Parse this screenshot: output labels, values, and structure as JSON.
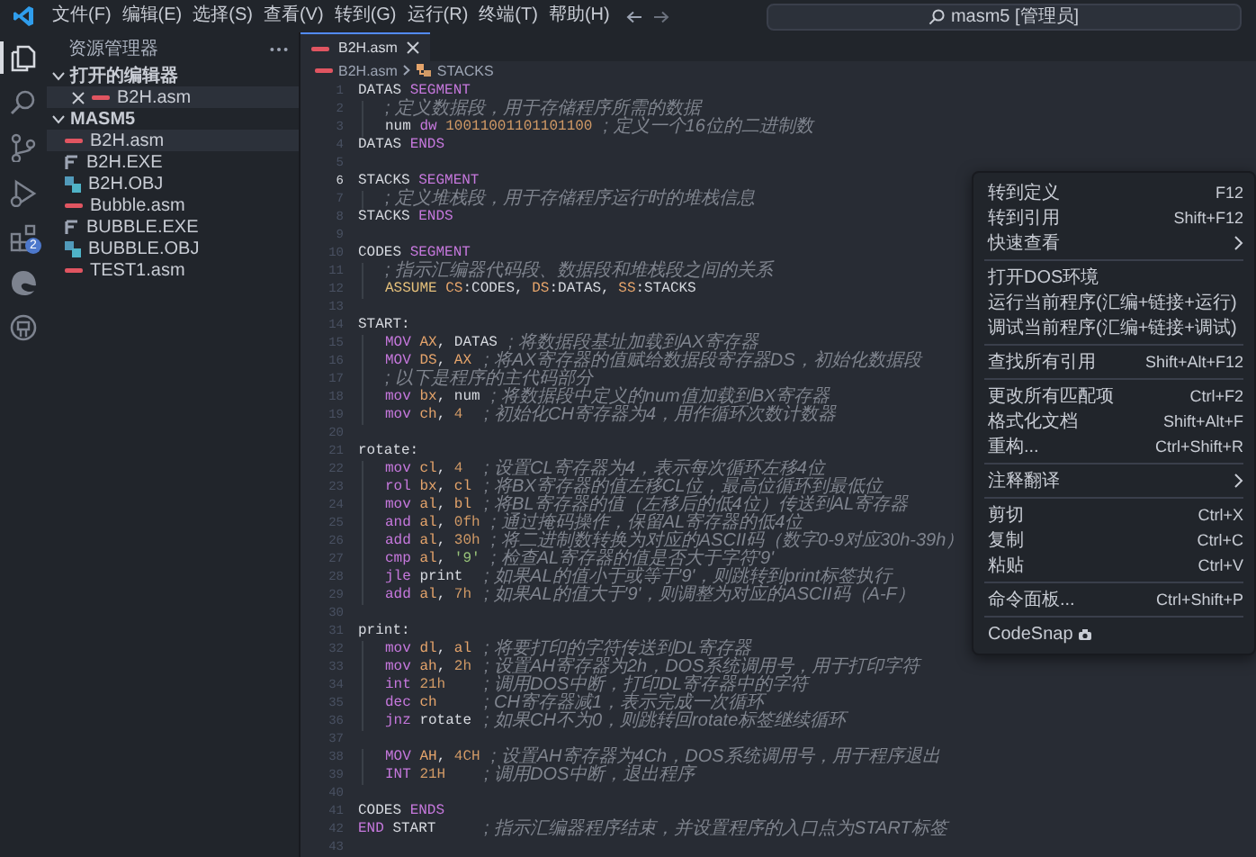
{
  "title_bar": {
    "menus": [
      "文件(F)",
      "编辑(E)",
      "选择(S)",
      "查看(V)",
      "转到(G)",
      "运行(R)",
      "终端(T)",
      "帮助(H)"
    ],
    "command_center": "masm5 [管理员]"
  },
  "activity_bar": {
    "items": [
      {
        "kind": "explorer",
        "selected": true
      },
      {
        "kind": "search",
        "selected": false
      },
      {
        "kind": "source-control",
        "selected": false
      },
      {
        "kind": "run",
        "selected": false
      },
      {
        "kind": "extensions",
        "selected": false,
        "badge": "2"
      },
      {
        "kind": "edge",
        "selected": false
      },
      {
        "kind": "github",
        "selected": false
      }
    ]
  },
  "sidebar": {
    "title": "资源管理器",
    "sections": [
      {
        "title": "打开的编辑器",
        "expanded": true,
        "items": [
          {
            "name": "B2H.asm",
            "kind": "asm",
            "selected": true,
            "closable": true
          }
        ]
      },
      {
        "title": "MASM5",
        "expanded": true,
        "items": [
          {
            "name": "B2H.asm",
            "kind": "asm",
            "selected": true,
            "closable": false
          },
          {
            "name": "B2H.EXE",
            "kind": "exe",
            "selected": false,
            "closable": false
          },
          {
            "name": "B2H.OBJ",
            "kind": "obj",
            "selected": false,
            "closable": false
          },
          {
            "name": "Bubble.asm",
            "kind": "asm",
            "selected": false,
            "closable": false
          },
          {
            "name": "BUBBLE.EXE",
            "kind": "exe",
            "selected": false,
            "closable": false
          },
          {
            "name": "BUBBLE.OBJ",
            "kind": "obj",
            "selected": false,
            "closable": false
          },
          {
            "name": "TEST1.asm",
            "kind": "asm",
            "selected": false,
            "closable": false
          }
        ]
      }
    ]
  },
  "editor": {
    "tabs": [
      {
        "label": "B2H.asm",
        "selected": true
      }
    ],
    "breadcrumb": [
      {
        "label": "B2H.asm",
        "kind": "file"
      },
      {
        "label": "STACKS",
        "kind": "symbol"
      }
    ],
    "lines": [
      {
        "number": "1",
        "current": false,
        "indented": false,
        "code": [
          {
            "text": "DATAS",
            "kind": "plain"
          },
          {
            "text": "SEGMENT",
            "kind": "keyword"
          }
        ]
      },
      {
        "number": "2",
        "current": false,
        "indented": true,
        "comment": "; 定义数据段，用于存储程序所需的数据"
      },
      {
        "number": "3",
        "current": false,
        "indented": true,
        "code": [
          {
            "text": "num",
            "kind": "plain"
          },
          {
            "text": "dw",
            "kind": "keyword"
          },
          {
            "text": "10011001101101100",
            "kind": "number"
          }
        ],
        "comment": "; 定义一个16位的二进制数"
      },
      {
        "number": "4",
        "current": false,
        "indented": false,
        "code": [
          {
            "text": "DATAS",
            "kind": "plain"
          },
          {
            "text": "ENDS",
            "kind": "keyword"
          }
        ]
      },
      {
        "number": "5",
        "current": false,
        "indented": false
      },
      {
        "number": "6",
        "current": true,
        "indented": false,
        "code": [
          {
            "text": "STACKS",
            "kind": "plain"
          },
          {
            "text": "SEGMENT",
            "kind": "keyword"
          }
        ]
      },
      {
        "number": "7",
        "current": false,
        "indented": true,
        "comment": "; 定义堆栈段，用于存储程序运行时的堆栈信息"
      },
      {
        "number": "8",
        "current": false,
        "indented": false,
        "code": [
          {
            "text": "STACKS",
            "kind": "plain"
          },
          {
            "text": "ENDS",
            "kind": "keyword"
          }
        ]
      },
      {
        "number": "9",
        "current": false,
        "indented": false
      },
      {
        "number": "10",
        "current": false,
        "indented": false,
        "code": [
          {
            "text": "CODES",
            "kind": "plain"
          },
          {
            "text": "SEGMENT",
            "kind": "keyword"
          }
        ]
      },
      {
        "number": "11",
        "current": false,
        "indented": true,
        "comment": "; 指示汇编器代码段、数据段和堆栈段之间的关系"
      },
      {
        "number": "12",
        "current": false,
        "indented": true,
        "code": [
          {
            "text": "ASSUME",
            "kind": "directive"
          },
          {
            "text": "CS",
            "kind": "register"
          },
          {
            "text": ":CODES,",
            "kind": "punct"
          },
          {
            "text": "DS",
            "kind": "register"
          },
          {
            "text": ":DATAS,",
            "kind": "punct"
          },
          {
            "text": "SS",
            "kind": "register"
          },
          {
            "text": ":STACKS",
            "kind": "punct"
          }
        ]
      },
      {
        "number": "13",
        "current": false,
        "indented": false
      },
      {
        "number": "14",
        "current": false,
        "indented": false,
        "code": [
          {
            "text": "START:",
            "kind": "plain"
          }
        ]
      },
      {
        "number": "15",
        "current": false,
        "indented": true,
        "code": [
          {
            "text": "MOV",
            "kind": "keyword"
          },
          {
            "text": "AX",
            "kind": "register"
          },
          {
            "text": ",",
            "kind": "punct"
          },
          {
            "text": "DATAS",
            "kind": "plain"
          }
        ],
        "comment": "; 将数据段基址加载到AX寄存器"
      },
      {
        "number": "16",
        "current": false,
        "indented": true,
        "code": [
          {
            "text": "MOV",
            "kind": "keyword"
          },
          {
            "text": "DS",
            "kind": "register"
          },
          {
            "text": ",",
            "kind": "punct"
          },
          {
            "text": "AX",
            "kind": "register"
          }
        ],
        "comment": "; 将AX寄存器的值赋给数据段寄存器DS，初始化数据段"
      },
      {
        "number": "17",
        "current": false,
        "indented": true,
        "comment": "; 以下是程序的主代码部分"
      },
      {
        "number": "18",
        "current": false,
        "indented": true,
        "code": [
          {
            "text": "mov",
            "kind": "keyword"
          },
          {
            "text": "bx",
            "kind": "register"
          },
          {
            "text": ",",
            "kind": "punct"
          },
          {
            "text": "num",
            "kind": "plain"
          }
        ],
        "comment": "; 将数据段中定义的num值加载到BX寄存器"
      },
      {
        "number": "19",
        "current": false,
        "indented": true,
        "code": [
          {
            "text": "mov",
            "kind": "keyword"
          },
          {
            "text": "ch",
            "kind": "register"
          },
          {
            "text": ",",
            "kind": "punct"
          },
          {
            "text": "4",
            "kind": "number"
          }
        ],
        "comment": "; 初始化CH寄存器为4，用作循环次数计数器"
      },
      {
        "number": "20",
        "current": false,
        "indented": false
      },
      {
        "number": "21",
        "current": false,
        "indented": false,
        "code": [
          {
            "text": "rotate:",
            "kind": "plain"
          }
        ]
      },
      {
        "number": "22",
        "current": false,
        "indented": true,
        "code": [
          {
            "text": "mov",
            "kind": "keyword"
          },
          {
            "text": "cl",
            "kind": "register"
          },
          {
            "text": ",",
            "kind": "punct"
          },
          {
            "text": "4",
            "kind": "number"
          }
        ],
        "comment": "; 设置CL寄存器为4，表示每次循环左移4位"
      },
      {
        "number": "23",
        "current": false,
        "indented": true,
        "code": [
          {
            "text": "rol",
            "kind": "keyword"
          },
          {
            "text": "bx",
            "kind": "register"
          },
          {
            "text": ",",
            "kind": "punct"
          },
          {
            "text": "cl",
            "kind": "register"
          }
        ],
        "comment": "; 将BX寄存器的值左移CL位，最高位循环到最低位"
      },
      {
        "number": "24",
        "current": false,
        "indented": true,
        "code": [
          {
            "text": "mov",
            "kind": "keyword"
          },
          {
            "text": "al",
            "kind": "register"
          },
          {
            "text": ",",
            "kind": "punct"
          },
          {
            "text": "bl",
            "kind": "register"
          }
        ],
        "comment": "; 将BL寄存器的值（左移后的低4位）传送到AL寄存器"
      },
      {
        "number": "25",
        "current": false,
        "indented": true,
        "code": [
          {
            "text": "and",
            "kind": "keyword"
          },
          {
            "text": "al",
            "kind": "register"
          },
          {
            "text": ",",
            "kind": "punct"
          },
          {
            "text": "0fh",
            "kind": "number"
          }
        ],
        "comment": "; 通过掩码操作，保留AL寄存器的低4位"
      },
      {
        "number": "26",
        "current": false,
        "indented": true,
        "code": [
          {
            "text": "add",
            "kind": "keyword"
          },
          {
            "text": "al",
            "kind": "register"
          },
          {
            "text": ",",
            "kind": "punct"
          },
          {
            "text": "30h",
            "kind": "number"
          }
        ],
        "comment": "; 将二进制数转换为对应的ASCII码（数字0-9对应30h-39h）"
      },
      {
        "number": "27",
        "current": false,
        "indented": true,
        "code": [
          {
            "text": "cmp",
            "kind": "keyword"
          },
          {
            "text": "al",
            "kind": "register"
          },
          {
            "text": ",",
            "kind": "punct"
          },
          {
            "text": "'9'",
            "kind": "string"
          }
        ],
        "comment": "; 检查AL寄存器的值是否大于字符'9'"
      },
      {
        "number": "28",
        "current": false,
        "indented": true,
        "code": [
          {
            "text": "jle",
            "kind": "keyword"
          },
          {
            "text": "print",
            "kind": "plain"
          }
        ],
        "comment": "; 如果AL的值小于或等于'9'，则跳转到print标签执行"
      },
      {
        "number": "29",
        "current": false,
        "indented": true,
        "code": [
          {
            "text": "add",
            "kind": "keyword"
          },
          {
            "text": "al",
            "kind": "register"
          },
          {
            "text": ",",
            "kind": "punct"
          },
          {
            "text": "7h",
            "kind": "number"
          }
        ],
        "comment": "; 如果AL的值大于'9'，则调整为对应的ASCII码（A-F）"
      },
      {
        "number": "30",
        "current": false,
        "indented": false
      },
      {
        "number": "31",
        "current": false,
        "indented": false,
        "code": [
          {
            "text": "print:",
            "kind": "plain"
          }
        ]
      },
      {
        "number": "32",
        "current": false,
        "indented": true,
        "code": [
          {
            "text": "mov",
            "kind": "keyword"
          },
          {
            "text": "dl",
            "kind": "register"
          },
          {
            "text": ",",
            "kind": "punct"
          },
          {
            "text": "al",
            "kind": "register"
          }
        ],
        "comment": "; 将要打印的字符传送到DL寄存器"
      },
      {
        "number": "33",
        "current": false,
        "indented": true,
        "code": [
          {
            "text": "mov",
            "kind": "keyword"
          },
          {
            "text": "ah",
            "kind": "register"
          },
          {
            "text": ",",
            "kind": "punct"
          },
          {
            "text": "2h",
            "kind": "number"
          }
        ],
        "comment": "; 设置AH寄存器为2h，DOS系统调用号，用于打印字符"
      },
      {
        "number": "34",
        "current": false,
        "indented": true,
        "code": [
          {
            "text": "int",
            "kind": "keyword"
          },
          {
            "text": "21h",
            "kind": "number"
          }
        ],
        "comment": "; 调用DOS中断，打印DL寄存器中的字符"
      },
      {
        "number": "35",
        "current": false,
        "indented": true,
        "code": [
          {
            "text": "dec",
            "kind": "keyword"
          },
          {
            "text": "ch",
            "kind": "register"
          }
        ],
        "comment": "; CH寄存器减1，表示完成一次循环"
      },
      {
        "number": "36",
        "current": false,
        "indented": true,
        "code": [
          {
            "text": "jnz",
            "kind": "keyword"
          },
          {
            "text": "rotate",
            "kind": "plain"
          }
        ],
        "comment": "; 如果CH不为0，则跳转回rotate标签继续循环"
      },
      {
        "number": "37",
        "current": false,
        "indented": false
      },
      {
        "number": "38",
        "current": false,
        "indented": true,
        "code": [
          {
            "text": "MOV",
            "kind": "keyword"
          },
          {
            "text": "AH",
            "kind": "register"
          },
          {
            "text": ",",
            "kind": "punct"
          },
          {
            "text": "4CH",
            "kind": "number"
          }
        ],
        "comment": "; 设置AH寄存器为4Ch，DOS系统调用号，用于程序退出"
      },
      {
        "number": "39",
        "current": false,
        "indented": true,
        "code": [
          {
            "text": "INT",
            "kind": "keyword"
          },
          {
            "text": "21H",
            "kind": "number"
          }
        ],
        "comment": "; 调用DOS中断，退出程序"
      },
      {
        "number": "40",
        "current": false,
        "indented": false
      },
      {
        "number": "41",
        "current": false,
        "indented": false,
        "code": [
          {
            "text": "CODES",
            "kind": "plain"
          },
          {
            "text": "ENDS",
            "kind": "keyword"
          }
        ]
      },
      {
        "number": "42",
        "current": false,
        "indented": false,
        "code": [
          {
            "text": "END",
            "kind": "keyword"
          },
          {
            "text": "START",
            "kind": "plain"
          }
        ],
        "comment": "; 指示汇编器程序结束，并设置程序的入口点为START标签"
      },
      {
        "number": "43",
        "current": false,
        "indented": false
      }
    ]
  },
  "context_menu": {
    "groups": [
      {
        "items": [
          {
            "label": "转到定义",
            "shortcut": "F12",
            "kind": "command"
          },
          {
            "label": "转到引用",
            "shortcut": "Shift+F12",
            "kind": "command"
          },
          {
            "label": "快速查看",
            "kind": "submenu"
          }
        ]
      },
      {
        "items": [
          {
            "label": "打开DOS环境",
            "kind": "command"
          },
          {
            "label": "运行当前程序(汇编+链接+运行)",
            "kind": "command"
          },
          {
            "label": "调试当前程序(汇编+链接+调试)",
            "kind": "command"
          }
        ]
      },
      {
        "items": [
          {
            "label": "查找所有引用",
            "shortcut": "Shift+Alt+F12",
            "kind": "command"
          }
        ]
      },
      {
        "items": [
          {
            "label": "更改所有匹配项",
            "shortcut": "Ctrl+F2",
            "kind": "command"
          },
          {
            "label": "格式化文档",
            "shortcut": "Shift+Alt+F",
            "kind": "command"
          },
          {
            "label": "重构...",
            "shortcut": "Ctrl+Shift+R",
            "kind": "command"
          }
        ]
      },
      {
        "items": [
          {
            "label": "注释翻译",
            "kind": "submenu"
          }
        ]
      },
      {
        "items": [
          {
            "label": "剪切",
            "shortcut": "Ctrl+X",
            "kind": "command"
          },
          {
            "label": "复制",
            "shortcut": "Ctrl+C",
            "kind": "command"
          },
          {
            "label": "粘贴",
            "shortcut": "Ctrl+V",
            "kind": "command"
          }
        ]
      },
      {
        "items": [
          {
            "label": "命令面板...",
            "shortcut": "Ctrl+Shift+P",
            "kind": "command"
          }
        ]
      },
      {
        "items": [
          {
            "label": "CodeSnap",
            "kind": "extension"
          }
        ]
      }
    ]
  }
}
